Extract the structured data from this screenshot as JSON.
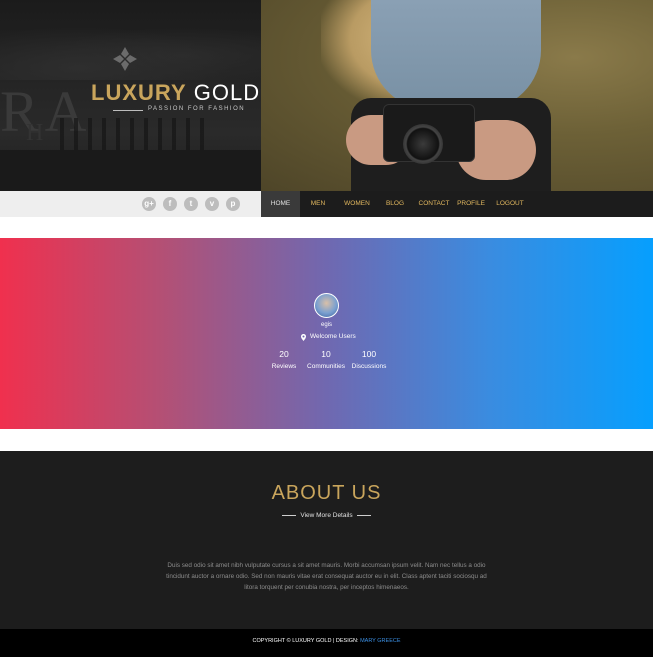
{
  "brand": {
    "name_gold": "LUXURY",
    "name_white": "GOLD",
    "tagline": "PASSION FOR FASHION",
    "accent_color": "#c9a55c"
  },
  "hero_left_bg_text": {
    "line1": "RA",
    "line2": "H"
  },
  "social": [
    {
      "icon": "google-plus-icon",
      "glyph": "g+"
    },
    {
      "icon": "facebook-icon",
      "glyph": "f"
    },
    {
      "icon": "twitter-icon",
      "glyph": "t"
    },
    {
      "icon": "vimeo-icon",
      "glyph": "v"
    },
    {
      "icon": "pinterest-icon",
      "glyph": "p"
    }
  ],
  "nav": {
    "items": [
      {
        "label": "HOME",
        "active": true
      },
      {
        "label": "MEN",
        "active": false
      },
      {
        "label": "WOMEN",
        "active": false
      },
      {
        "label": "BLOG",
        "active": false
      },
      {
        "label": "CONTACT",
        "active": false
      },
      {
        "label": "PROFILE",
        "active": false
      },
      {
        "label": "LOGOUT",
        "active": false
      }
    ],
    "text_color": "#e2b85f"
  },
  "profile": {
    "username": "egis",
    "location_icon": "map-pin-icon",
    "welcome": "Welcome Users",
    "stats": [
      {
        "value": "20",
        "label": "Reviews"
      },
      {
        "value": "10",
        "label": "Communities"
      },
      {
        "value": "100",
        "label": "Discussions"
      }
    ],
    "gradient_from": "#f0304e",
    "gradient_to": "#069ffe"
  },
  "about": {
    "title": "ABOUT US",
    "link": "View More Details",
    "body": "Duis sed odio sit amet nibh vulputate cursus a sit amet mauris. Morbi accumsan ipsum velit. Nam nec tellus a odio tincidunt auctor a ornare odio. Sed non mauris vitae erat consequat auctor eu in elit. Class aptent taciti sociosqu ad litora torquent per conubia nostra, per inceptos himenaeos."
  },
  "footer": {
    "copyright": "COPYRIGHT © LUXURY GOLD | DESIGN:",
    "designer": "MARY GREECE"
  }
}
